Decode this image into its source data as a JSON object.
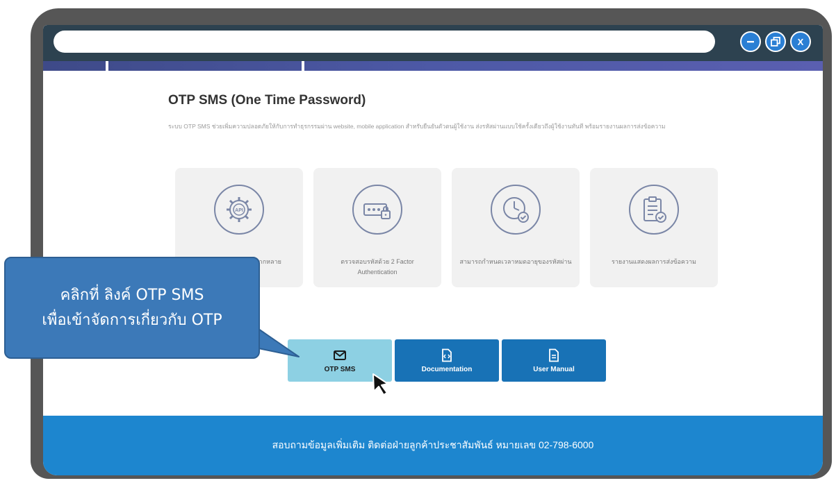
{
  "window": {
    "controls": [
      {
        "name": "minimize",
        "icon": "minus-icon"
      },
      {
        "name": "restore",
        "icon": "restore-icon"
      },
      {
        "name": "close",
        "icon": "close-icon",
        "label": "X"
      }
    ],
    "accent": "#2a7fd4"
  },
  "page": {
    "title": "OTP SMS (One Time Password)",
    "description": "ระบบ OTP SMS ช่วยเพิ่มความปลอดภัยให้กับการทำธุรกรรมผ่าน website, mobile application สำหรับยืนยันตัวตนผู้ใช้งาน ส่งรหัสผ่านแบบใช้ครั้งเดียวถึงผู้ใช้งานทันที พร้อมรายงานผลการส่งข้อความ"
  },
  "features": [
    {
      "icon": "api-gear-icon",
      "label": "เชื่อมต่อผ่าน API ได้หลากหลาย"
    },
    {
      "icon": "password-lock-icon",
      "label": "ตรวจสอบรหัสด้วย 2 Factor Authentication"
    },
    {
      "icon": "clock-check-icon",
      "label": "สามารถกำหนดเวลาหมดอายุของรหัสผ่าน"
    },
    {
      "icon": "clipboard-report-icon",
      "label": "รายงานแสดงผลการส่งข้อความ"
    }
  ],
  "actions": [
    {
      "label": "OTP SMS",
      "icon": "envelope-icon",
      "active": true
    },
    {
      "label": "Documentation",
      "icon": "code-document-icon",
      "active": false
    },
    {
      "label": "User Manual",
      "icon": "document-icon",
      "active": false
    }
  ],
  "footer": {
    "text": "สอบถามข้อมูลเพิ่มเติม ติดต่อฝ่ายลูกค้าประชาสัมพันธ์ หมายเลข 02-798-6000"
  },
  "callout": {
    "line1": "คลิกที่ ลิงค์ OTP SMS",
    "line2": "เพื่อเข้าจัดการเกี่ยวกับ OTP"
  },
  "colors": {
    "frame": "#565656",
    "titlebar": "#2d4250",
    "button": "#1872b6",
    "button_active": "#8dd0e3",
    "footer": "#1d86cf",
    "callout": "#3c79b8"
  }
}
